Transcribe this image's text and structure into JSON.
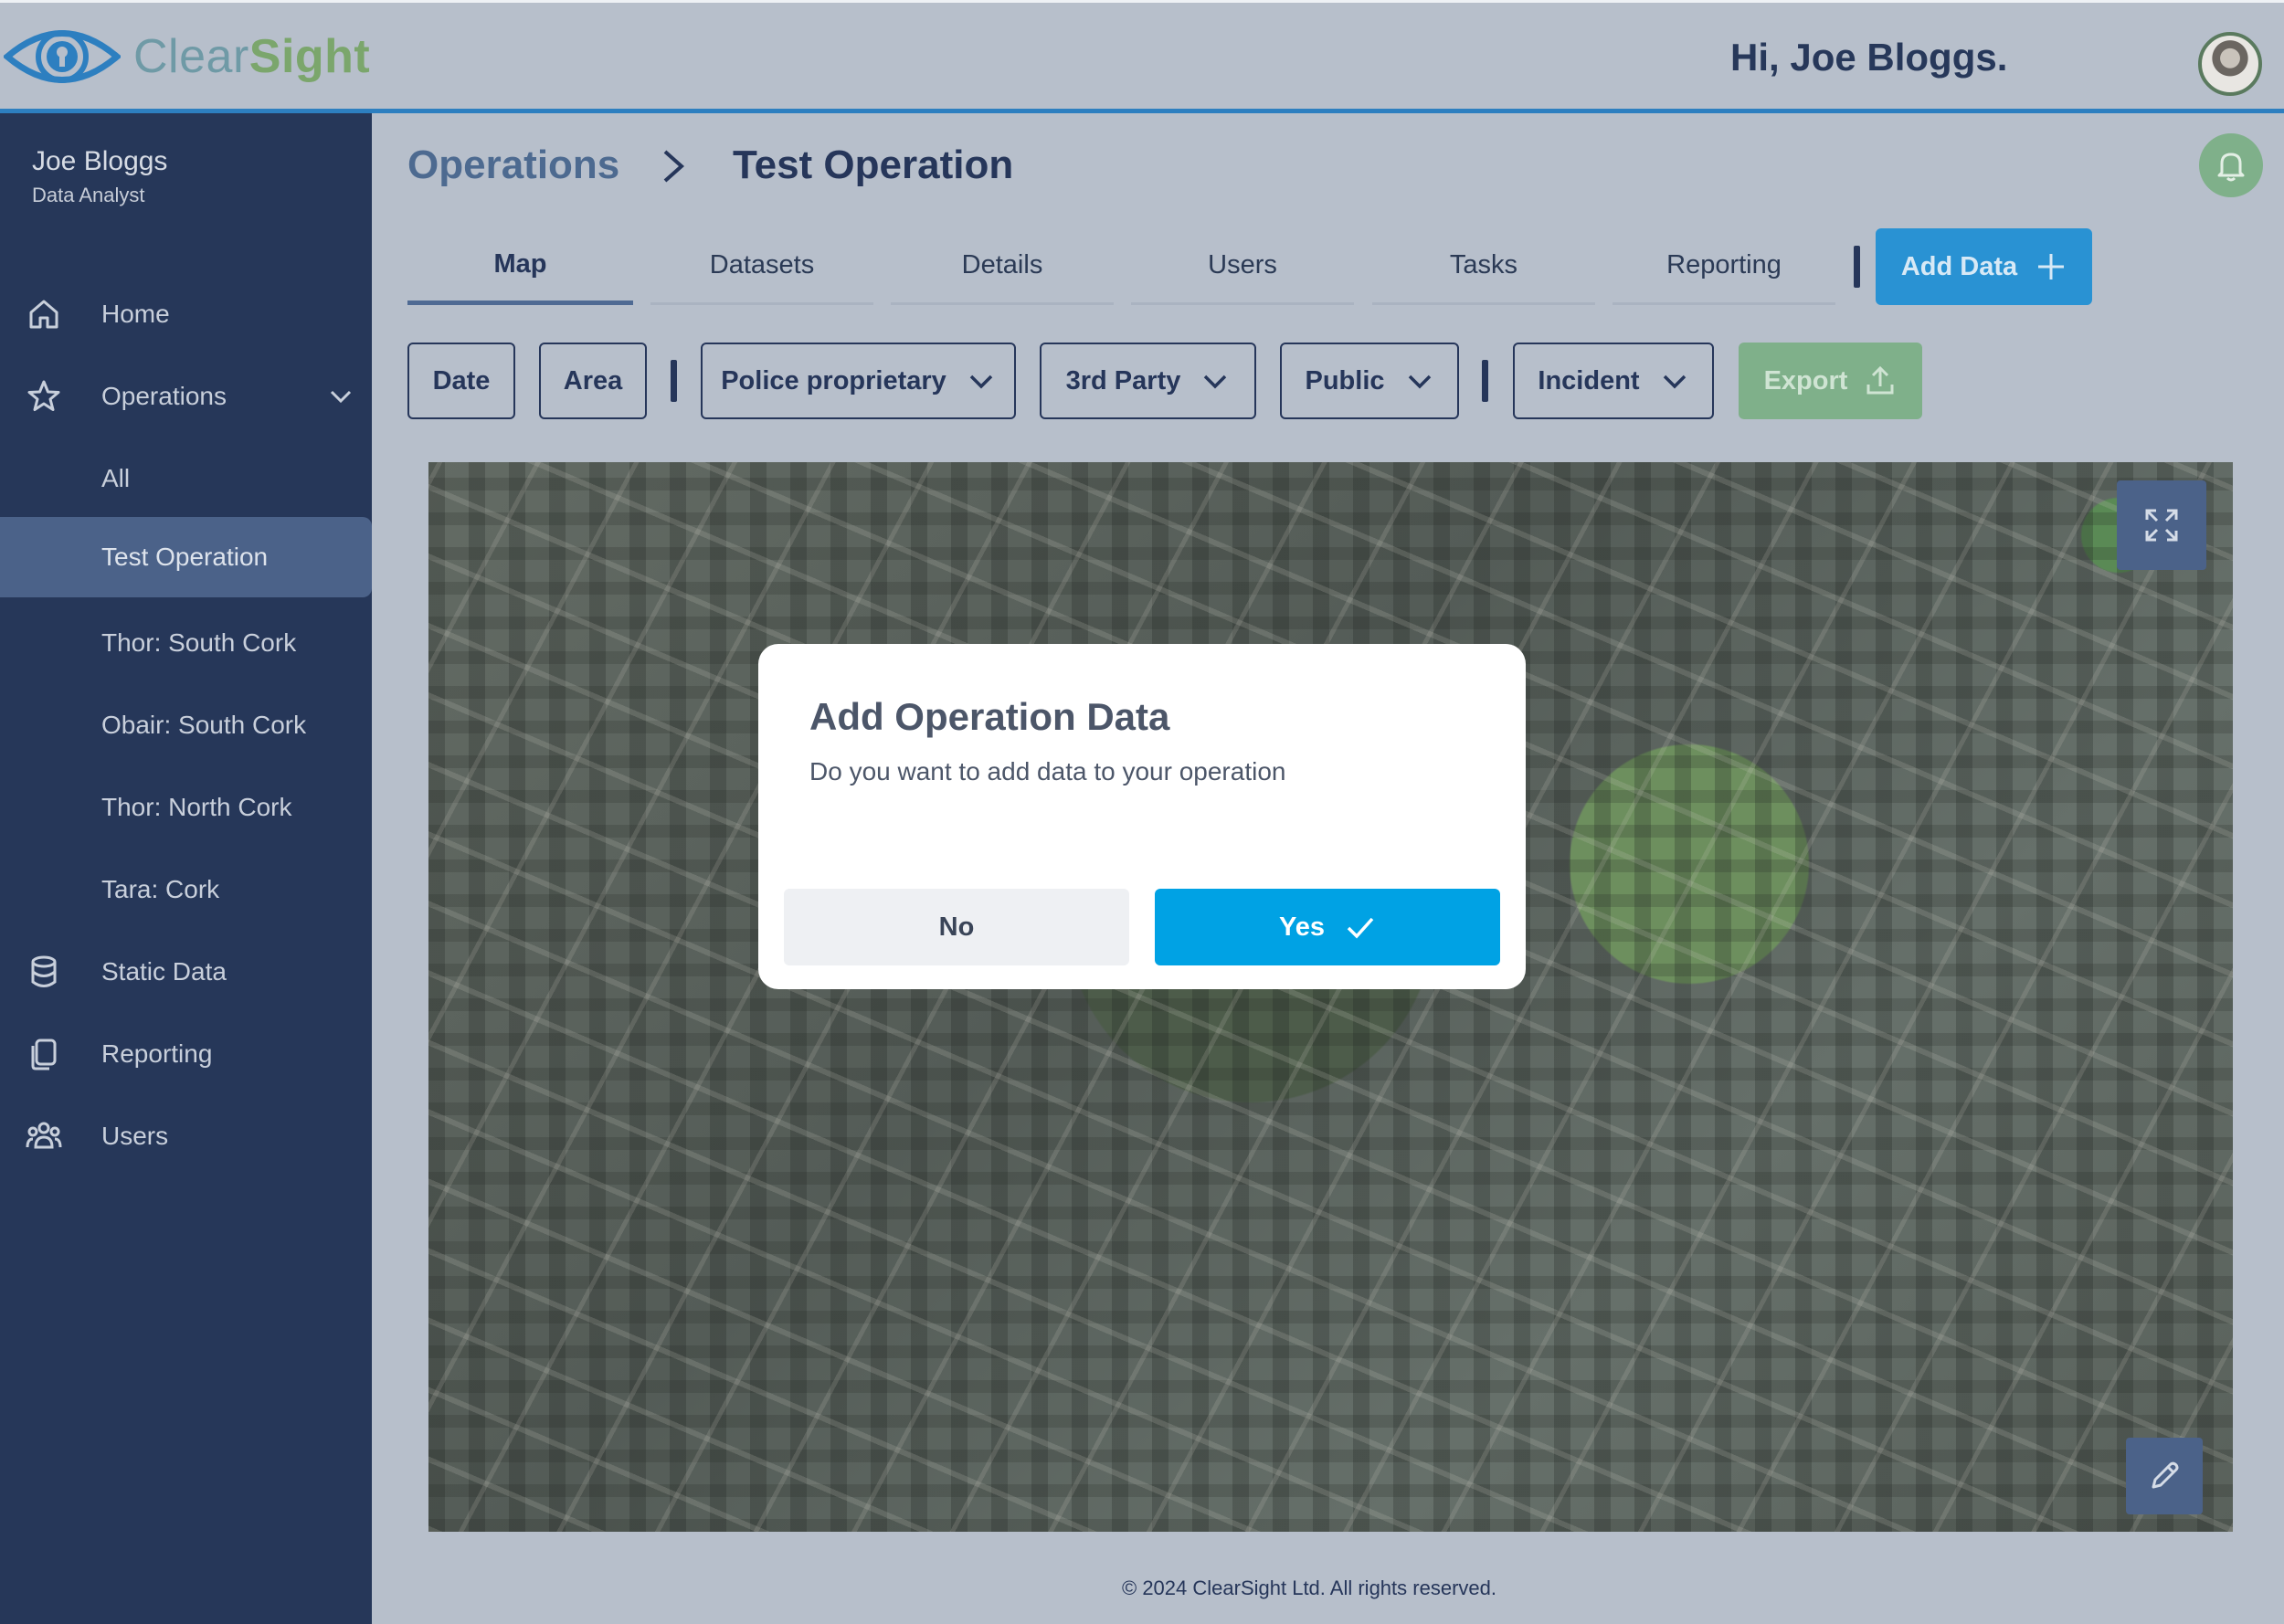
{
  "header": {
    "logo_text_light": "Clear",
    "logo_text_bold": "Sight",
    "greeting": "Hi, Joe Bloggs."
  },
  "sidebar": {
    "user_name": "Joe Bloggs",
    "user_role": "Data Analyst",
    "items": [
      {
        "label": "Home",
        "icon": "home-icon"
      },
      {
        "label": "Operations",
        "icon": "star-icon"
      },
      {
        "label": "All"
      },
      {
        "label": "Test Operation"
      },
      {
        "label": "Thor: South Cork"
      },
      {
        "label": "Obair: South Cork"
      },
      {
        "label": "Thor: North Cork"
      },
      {
        "label": "Tara: Cork"
      },
      {
        "label": "Static Data",
        "icon": "database-icon"
      },
      {
        "label": "Reporting",
        "icon": "documents-icon"
      },
      {
        "label": "Users",
        "icon": "users-icon"
      }
    ]
  },
  "breadcrumb": {
    "parent": "Operations",
    "current": "Test Operation"
  },
  "tabs": [
    "Map",
    "Datasets",
    "Details",
    "Users",
    "Tasks",
    "Reporting"
  ],
  "add_data_label": "Add Data",
  "filters": {
    "date": "Date",
    "area": "Area",
    "police": "Police proprietary",
    "third_party": "3rd Party",
    "public": "Public",
    "incident": "Incident",
    "export": "Export"
  },
  "modal": {
    "title": "Add Operation Data",
    "text": "Do you want to add data to your operation",
    "no_label": "No",
    "yes_label": "Yes"
  },
  "footer": "© 2024 ClearSight Ltd. All rights reserved.",
  "colors": {
    "sidebar": "#263759",
    "accent_blue": "#2992d3",
    "modal_yes": "#00a2e4",
    "export_green": "#7fb08a"
  }
}
